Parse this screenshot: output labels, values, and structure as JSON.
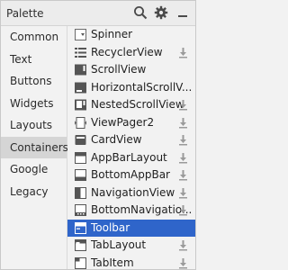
{
  "panel": {
    "title": "Palette"
  },
  "categories": [
    {
      "label": "Common"
    },
    {
      "label": "Text"
    },
    {
      "label": "Buttons"
    },
    {
      "label": "Widgets"
    },
    {
      "label": "Layouts"
    },
    {
      "label": "Containers",
      "selected": true
    },
    {
      "label": "Google"
    },
    {
      "label": "Legacy"
    }
  ],
  "items": [
    {
      "label": "Spinner",
      "icon": "spinner-icon",
      "download": false
    },
    {
      "label": "RecyclerView",
      "icon": "recyclerview-icon",
      "download": true
    },
    {
      "label": "ScrollView",
      "icon": "scrollview-icon",
      "download": false
    },
    {
      "label": "HorizontalScrollV...",
      "icon": "horizontal-scrollview-icon",
      "download": false
    },
    {
      "label": "NestedScrollView",
      "icon": "nested-scrollview-icon",
      "download": true
    },
    {
      "label": "ViewPager2",
      "icon": "viewpager-icon",
      "download": true
    },
    {
      "label": "CardView",
      "icon": "cardview-icon",
      "download": true
    },
    {
      "label": "AppBarLayout",
      "icon": "appbar-icon",
      "download": true
    },
    {
      "label": "BottomAppBar",
      "icon": "bottom-appbar-icon",
      "download": true
    },
    {
      "label": "NavigationView",
      "icon": "navigation-view-icon",
      "download": true
    },
    {
      "label": "BottomNavigatio...",
      "icon": "bottom-navigation-icon",
      "download": true
    },
    {
      "label": "Toolbar",
      "icon": "toolbar-icon",
      "download": false,
      "selected": true
    },
    {
      "label": "TabLayout",
      "icon": "tablayout-icon",
      "download": true
    },
    {
      "label": "TabItem",
      "icon": "tabitem-icon",
      "download": true
    }
  ],
  "colors": {
    "selection": "#2f65ca",
    "category_selection": "#d5d5d5"
  }
}
